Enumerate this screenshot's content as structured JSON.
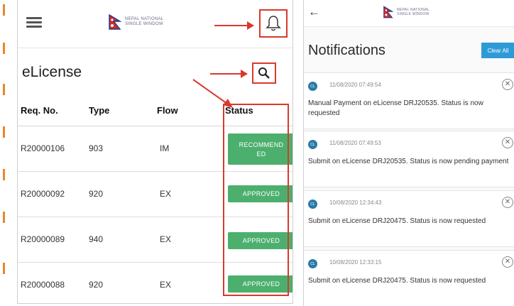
{
  "left": {
    "logo_line1": "NEPAL NATIONAL",
    "logo_line2": "SINGLE WINDOW",
    "title": "eLicense",
    "columns": [
      "Req. No.",
      "Type",
      "Flow",
      "Status"
    ],
    "rows": [
      {
        "req": "R20000106",
        "type": "903",
        "flow": "IM",
        "status_line1": "RECOMMEND",
        "status_line2": "ED"
      },
      {
        "req": "R20000092",
        "type": "920",
        "flow": "EX",
        "status": "APPROVED"
      },
      {
        "req": "R20000089",
        "type": "940",
        "flow": "EX",
        "status": "APPROVED"
      },
      {
        "req": "R20000088",
        "type": "920",
        "flow": "EX",
        "status": "APPROVED"
      }
    ]
  },
  "right": {
    "logo_line1": "NEPAL NATIONAL",
    "logo_line2": "SINGLE WINDOW",
    "title": "Notifications",
    "clear_all": "Clear All",
    "notifications": [
      {
        "avatar": "CL",
        "time": "11/08/2020 07:49:54",
        "message": "Manual Payment on eLicense DRJ20535. Status is now requested",
        "close": "✕"
      },
      {
        "avatar": "CL",
        "time": "11/08/2020 07:49:53",
        "message": "Submit on eLicense DRJ20535. Status is now pending payment",
        "close": "✕"
      },
      {
        "avatar": "CL",
        "time": "10/08/2020 12:34:43",
        "message": "Submit on eLicense DRJ20475. Status is now requested",
        "close": "✕"
      },
      {
        "avatar": "CL",
        "time": "10/08/2020 12:33:15",
        "message": "Submit on eLicense DRJ20475. Status is now requested",
        "close": "✕"
      }
    ]
  },
  "colors": {
    "annotation_red": "#d9392b",
    "approved_green": "#4caf6e",
    "clear_blue": "#2f9bd6",
    "side_dash_orange": "#e8862c"
  },
  "icons": [
    "hamburger-icon",
    "nepal-flag-icon",
    "bell-icon",
    "search-icon",
    "back-arrow-icon",
    "close-icon"
  ]
}
